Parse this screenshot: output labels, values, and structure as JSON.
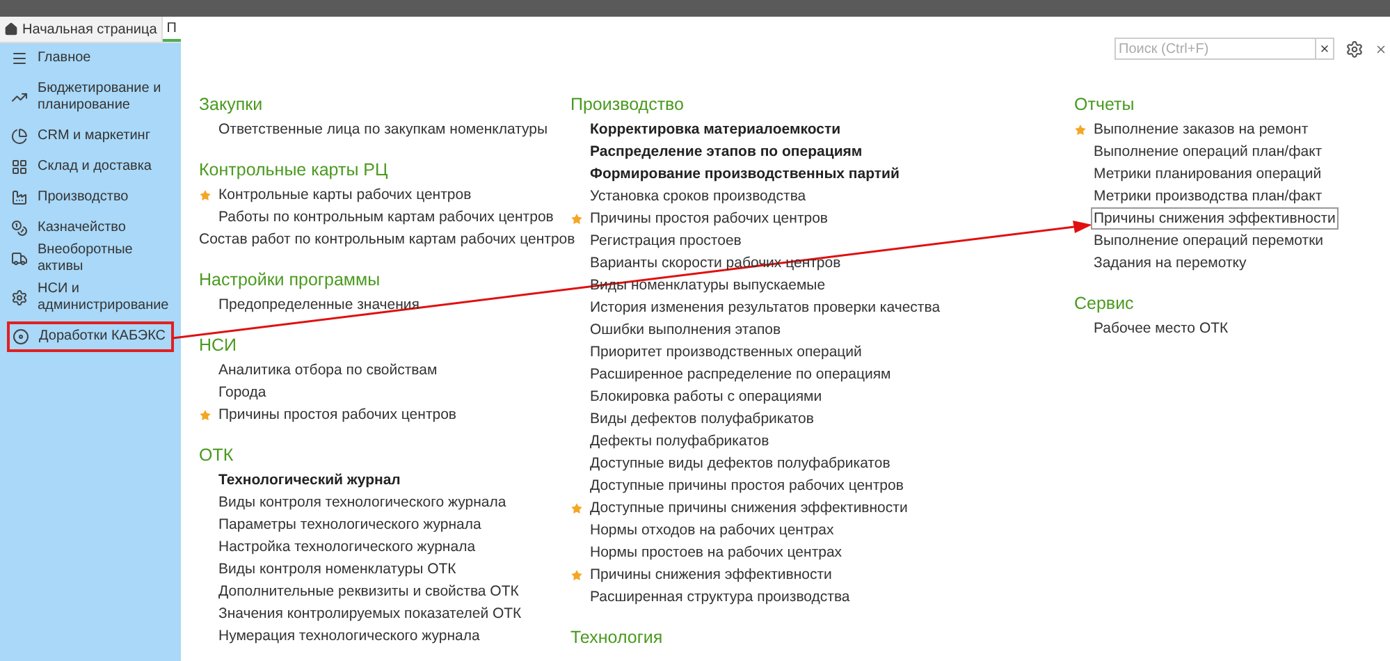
{
  "tabs": [
    {
      "label": "Начальная страница",
      "selected": false,
      "kind": "home"
    },
    {
      "label": "П",
      "selected": true,
      "kind": "page"
    }
  ],
  "search": {
    "placeholder": "Поиск (Ctrl+F)"
  },
  "sidebar": {
    "items": [
      {
        "label": "Главное",
        "highlighted": false
      },
      {
        "label": "Бюджетирование и планирование",
        "highlighted": false
      },
      {
        "label": "CRM и маркетинг",
        "highlighted": false
      },
      {
        "label": "Склад и доставка",
        "highlighted": false
      },
      {
        "label": "Производство",
        "highlighted": false
      },
      {
        "label": "Казначейство",
        "highlighted": false
      },
      {
        "label": "Внеоборотные активы",
        "highlighted": false
      },
      {
        "label": "НСИ и администрирование",
        "highlighted": false
      },
      {
        "label": "Доработки КАБЭКС",
        "highlighted": true
      }
    ]
  },
  "columns": [
    {
      "sections": [
        {
          "title": "Закупки",
          "items": [
            {
              "label": "Ответственные лица по закупкам номенклатуры",
              "starred": false,
              "bold": false,
              "focused": false
            }
          ]
        },
        {
          "title": "Контрольные карты РЦ",
          "items": [
            {
              "label": "Контрольные карты рабочих центров",
              "starred": true,
              "bold": false,
              "focused": false
            },
            {
              "label": "Работы по контрольным картам рабочих центров",
              "starred": false,
              "bold": false,
              "focused": false
            },
            {
              "label": "Состав работ по контрольным картам рабочих центров",
              "starred": false,
              "bold": false,
              "focused": false
            }
          ]
        },
        {
          "title": "Настройки программы",
          "items": [
            {
              "label": "Предопределенные значения",
              "starred": false,
              "bold": false,
              "focused": false
            }
          ]
        },
        {
          "title": "НСИ",
          "items": [
            {
              "label": "Аналитика отбора по свойствам",
              "starred": false,
              "bold": false,
              "focused": false
            },
            {
              "label": "Города",
              "starred": false,
              "bold": false,
              "focused": false
            },
            {
              "label": "Причины простоя рабочих центров",
              "starred": true,
              "bold": false,
              "focused": false
            }
          ]
        },
        {
          "title": "ОТК",
          "items": [
            {
              "label": "Технологический журнал",
              "starred": false,
              "bold": true,
              "focused": false
            },
            {
              "label": "Виды контроля технологического журнала",
              "starred": false,
              "bold": false,
              "focused": false
            },
            {
              "label": "Параметры технологического журнала",
              "starred": false,
              "bold": false,
              "focused": false
            },
            {
              "label": "Настройка технологического журнала",
              "starred": false,
              "bold": false,
              "focused": false
            },
            {
              "label": "Виды контроля номенклатуры ОТК",
              "starred": false,
              "bold": false,
              "focused": false
            },
            {
              "label": "Дополнительные реквизиты и свойства ОТК",
              "starred": false,
              "bold": false,
              "focused": false
            },
            {
              "label": "Значения контролируемых показателей ОТК",
              "starred": false,
              "bold": false,
              "focused": false
            },
            {
              "label": "Нумерация технологического журнала",
              "starred": false,
              "bold": false,
              "focused": false
            }
          ]
        }
      ]
    },
    {
      "sections": [
        {
          "title": "Производство",
          "items": [
            {
              "label": "Корректировка материалоемкости",
              "starred": false,
              "bold": true,
              "focused": false
            },
            {
              "label": "Распределение этапов по операциям",
              "starred": false,
              "bold": true,
              "focused": false
            },
            {
              "label": "Формирование производственных партий",
              "starred": false,
              "bold": true,
              "focused": false
            },
            {
              "label": "Установка сроков производства",
              "starred": false,
              "bold": false,
              "focused": false
            },
            {
              "label": "Причины простоя рабочих центров",
              "starred": true,
              "bold": false,
              "focused": false
            },
            {
              "label": "Регистрация простоев",
              "starred": false,
              "bold": false,
              "focused": false
            },
            {
              "label": "Варианты скорости рабочих центров",
              "starred": false,
              "bold": false,
              "focused": false
            },
            {
              "label": "Виды номенклатуры выпускаемые",
              "starred": false,
              "bold": false,
              "focused": false
            },
            {
              "label": "История изменения результатов проверки качества",
              "starred": false,
              "bold": false,
              "focused": false
            },
            {
              "label": "Ошибки выполнения этапов",
              "starred": false,
              "bold": false,
              "focused": false
            },
            {
              "label": "Приоритет производственных операций",
              "starred": false,
              "bold": false,
              "focused": false
            },
            {
              "label": "Расширенное распределение по операциям",
              "starred": false,
              "bold": false,
              "focused": false
            },
            {
              "label": "Блокировка работы с операциями",
              "starred": false,
              "bold": false,
              "focused": false
            },
            {
              "label": "Виды дефектов полуфабрикатов",
              "starred": false,
              "bold": false,
              "focused": false
            },
            {
              "label": "Дефекты полуфабрикатов",
              "starred": false,
              "bold": false,
              "focused": false
            },
            {
              "label": "Доступные виды дефектов полуфабрикатов",
              "starred": false,
              "bold": false,
              "focused": false
            },
            {
              "label": "Доступные причины простоя рабочих центров",
              "starred": false,
              "bold": false,
              "focused": false
            },
            {
              "label": "Доступные причины снижения эффективности",
              "starred": true,
              "bold": false,
              "focused": false
            },
            {
              "label": "Нормы отходов на рабочих центрах",
              "starred": false,
              "bold": false,
              "focused": false
            },
            {
              "label": "Нормы простоев на рабочих центрах",
              "starred": false,
              "bold": false,
              "focused": false
            },
            {
              "label": "Причины снижения эффективности",
              "starred": true,
              "bold": false,
              "focused": false
            },
            {
              "label": "Расширенная структура производства",
              "starred": false,
              "bold": false,
              "focused": false
            }
          ]
        },
        {
          "title": "Технология"
        }
      ]
    },
    {
      "sections": [
        {
          "title": "Отчеты",
          "items": [
            {
              "label": "Выполнение заказов на ремонт",
              "starred": true,
              "bold": false,
              "focused": false
            },
            {
              "label": "Выполнение операций план/факт",
              "starred": false,
              "bold": false,
              "focused": false
            },
            {
              "label": "Метрики планирования операций",
              "starred": false,
              "bold": false,
              "focused": false
            },
            {
              "label": "Метрики производства план/факт",
              "starred": false,
              "bold": false,
              "focused": false
            },
            {
              "label": "Причины снижения эффективности",
              "starred": false,
              "bold": false,
              "focused": true
            },
            {
              "label": "Выполнение операций перемотки",
              "starred": false,
              "bold": false,
              "focused": false
            },
            {
              "label": "Задания на перемотку",
              "starred": false,
              "bold": false,
              "focused": false
            }
          ]
        },
        {
          "title": "Сервис",
          "items": [
            {
              "label": "Рабочее место ОТК",
              "starred": false,
              "bold": false,
              "focused": false
            }
          ]
        }
      ]
    }
  ]
}
